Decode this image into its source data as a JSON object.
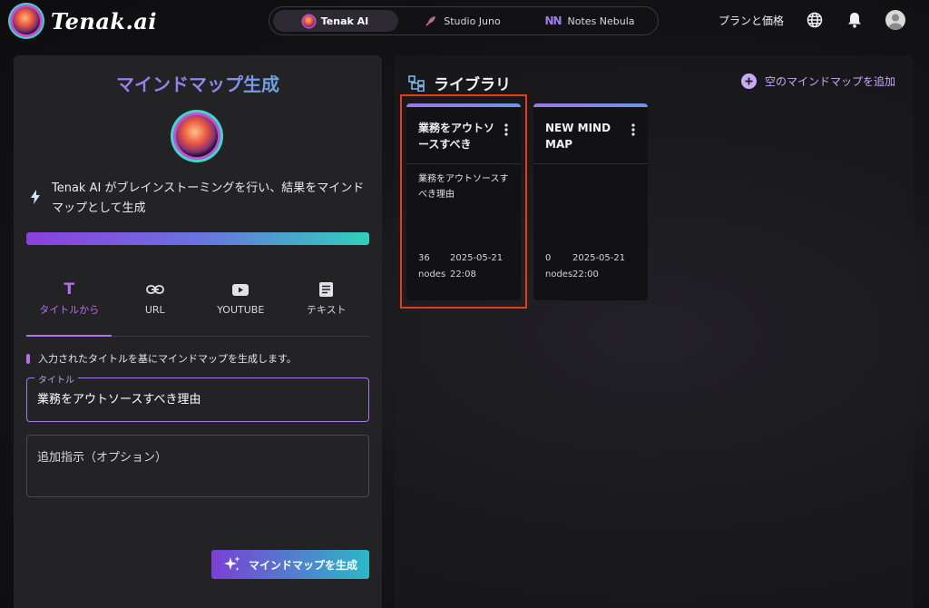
{
  "header": {
    "brand": "Tenak.ai",
    "apps": [
      {
        "label": "Tenak AI",
        "icon": "tenak-logo-icon",
        "active": true
      },
      {
        "label": "Studio Juno",
        "icon": "feather-icon",
        "active": false
      },
      {
        "label": "Notes Nebula",
        "icon": "nn-logo-icon",
        "active": false
      }
    ],
    "nn_glyph": "NN",
    "pricing_link": "プランと価格",
    "icons": [
      "globe-icon",
      "bell-icon",
      "user-avatar-icon"
    ]
  },
  "generator": {
    "title": "マインドマップ生成",
    "description": "Tenak AI がブレインストーミングを行い、結果をマインドマップとして生成",
    "tabs": [
      {
        "label": "タイトルから",
        "icon": "text-t-icon",
        "active": true
      },
      {
        "label": "URL",
        "icon": "link-icon",
        "active": false
      },
      {
        "label": "YOUTUBE",
        "icon": "youtube-icon",
        "active": false
      },
      {
        "label": "テキスト",
        "icon": "document-icon",
        "active": false
      }
    ],
    "tab_glyph_t": "T",
    "hint": "入力されたタイトルを基にマインドマップを生成します。",
    "title_field": {
      "label": "タイトル",
      "value": "業務をアウトソースすべき理由"
    },
    "extra_field": {
      "placeholder": "追加指示（オプション）",
      "value": ""
    },
    "generate_button": "マインドマップを生成",
    "accent_color": "#b86cf0"
  },
  "library": {
    "title": "ライブラリ",
    "add_empty": "空のマインドマップを追加",
    "cards": [
      {
        "title": "業務をアウトソースすべき",
        "description": "業務をアウトソースすべき理由",
        "nodes": "36",
        "nodes_label": "nodes",
        "date": "2025-05-21",
        "time": "22:08",
        "highlighted": true
      },
      {
        "title": "NEW MIND MAP",
        "description": "",
        "nodes": "0",
        "nodes_label": "nodes",
        "date": "2025-05-21",
        "time": "22:00",
        "highlighted": false
      }
    ],
    "highlight_color": "#ea3a1a"
  }
}
